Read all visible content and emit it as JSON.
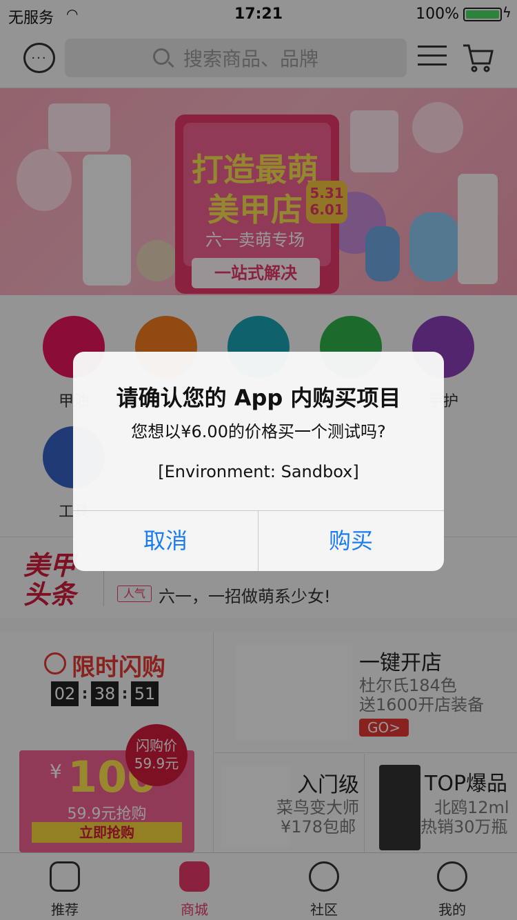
{
  "status_bar": {
    "carrier": "无服务",
    "time": "17:21",
    "battery": "100%"
  },
  "header": {
    "search_placeholder": "搜索商品、品牌"
  },
  "banner": {
    "date_line1": "5.31",
    "date_line2": "6.01",
    "title_line1": "打造最萌",
    "title_line2": "美甲店",
    "subtitle": "六一卖萌专场",
    "slogan": "一站式解决"
  },
  "categories": [
    {
      "label": "甲油",
      "color": "#e8175d"
    },
    {
      "label": "",
      "color": "#f07c1e"
    },
    {
      "label": "",
      "color": "#1aa3b3"
    },
    {
      "label": "",
      "color": "#2fb24b"
    },
    {
      "label": "手护",
      "color": "#8b3fb8"
    },
    {
      "label": "工具",
      "color": "#3461c1"
    }
  ],
  "news": {
    "logo_line1": "美甲",
    "logo_line2": "头条",
    "tag": "人气",
    "text": "六一，一招做萌系少女!"
  },
  "flash_sale": {
    "title": "限时闪购",
    "hours": "02",
    "minutes": "38",
    "seconds": "51",
    "coupon_yen": "¥",
    "coupon_value": "100",
    "coupon_sub": "59.9元抢购",
    "coupon_button": "立即抢购",
    "seal_line1": "闪购价",
    "seal_line2": "59.9元"
  },
  "promo_cells": {
    "shop": {
      "title": "一键开店",
      "line1": "杜尔氏184色",
      "line2": "送1600开店装备",
      "go": "GO>"
    },
    "starter": {
      "title": "入门级",
      "line1": "菜鸟变大师",
      "line2": "¥178包邮"
    },
    "top": {
      "title": "TOP爆品",
      "line1": "北鸥12ml",
      "line2": "热销30万瓶"
    }
  },
  "tabs": [
    {
      "label": "推荐",
      "active": false
    },
    {
      "label": "商城",
      "active": true
    },
    {
      "label": "社区",
      "active": false
    },
    {
      "label": "我的",
      "active": false
    }
  ],
  "alert": {
    "title": "请确认您的 App 内购买项目",
    "message": "您想以¥6.00的价格买一个测试吗?",
    "environment": "[Environment: Sandbox]",
    "cancel": "取消",
    "confirm": "购买"
  },
  "colors": {
    "accent": "#e63a6a",
    "alert_button": "#1a7cf5"
  }
}
